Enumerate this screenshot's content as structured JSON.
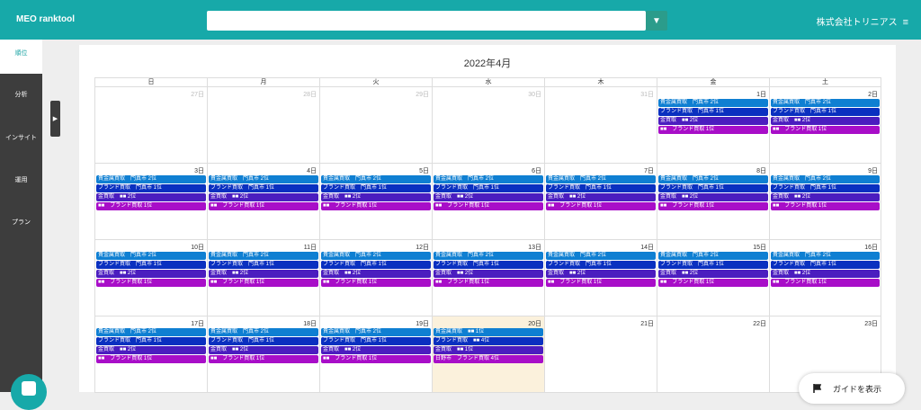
{
  "header": {
    "app_title": "MEO ranktool",
    "company": "株式会社トリニアス",
    "menu_icon": "hamburger-icon",
    "search_value": ""
  },
  "sidebar": {
    "items": [
      {
        "label": "順位",
        "active": true
      },
      {
        "label": "分析"
      },
      {
        "label": "インサイト"
      },
      {
        "label": "運用"
      },
      {
        "label": "プラン"
      }
    ],
    "toggle_icon": "▶"
  },
  "calendar": {
    "title": "2022年4月",
    "weekdays": [
      "日",
      "月",
      "火",
      "水",
      "木",
      "金",
      "土"
    ],
    "colors": {
      "blue1": "#0f7fd2",
      "blue2": "#0a30c0",
      "purple1": "#4b1dbf",
      "purple2": "#a80ec8",
      "today_bg": "#fbf1dc"
    },
    "weeks": [
      [
        {
          "label": "27日",
          "other": true,
          "events": []
        },
        {
          "label": "28日",
          "other": true,
          "events": []
        },
        {
          "label": "29日",
          "other": true,
          "events": []
        },
        {
          "label": "30日",
          "other": true,
          "events": []
        },
        {
          "label": "31日",
          "other": true,
          "events": []
        },
        {
          "label": "1日",
          "events": [
            {
              "text": "貴金属買取　門真市 2位",
              "color": "blue1"
            },
            {
              "text": "ブランド買取　門真市 1位",
              "color": "blue2"
            },
            {
              "text": "金買取　■■ 2位",
              "color": "purple1"
            },
            {
              "text": "■■　ブランド買取 1位",
              "color": "purple2"
            }
          ]
        },
        {
          "label": "2日",
          "events": [
            {
              "text": "貴金属買取　門真市 2位",
              "color": "blue1"
            },
            {
              "text": "ブランド買取　門真市 1位",
              "color": "blue2"
            },
            {
              "text": "金買取　■■ 2位",
              "color": "purple1"
            },
            {
              "text": "■■　ブランド買取 1位",
              "color": "purple2"
            }
          ]
        }
      ],
      [
        {
          "label": "3日",
          "events": [
            {
              "text": "貴金属買取　門真市 2位",
              "color": "blue1"
            },
            {
              "text": "ブランド買取　門真市 1位",
              "color": "blue2"
            },
            {
              "text": "金買取　■■ 2位",
              "color": "purple1"
            },
            {
              "text": "■■　ブランド買取 1位",
              "color": "purple2"
            }
          ]
        },
        {
          "label": "4日",
          "events": [
            {
              "text": "貴金属買取　門真市 2位",
              "color": "blue1"
            },
            {
              "text": "ブランド買取　門真市 1位",
              "color": "blue2"
            },
            {
              "text": "金買取　■■ 2位",
              "color": "purple1"
            },
            {
              "text": "■■　ブランド買取 1位",
              "color": "purple2"
            }
          ]
        },
        {
          "label": "5日",
          "events": [
            {
              "text": "貴金属買取　門真市 2位",
              "color": "blue1"
            },
            {
              "text": "ブランド買取　門真市 1位",
              "color": "blue2"
            },
            {
              "text": "金買取　■■ 2位",
              "color": "purple1"
            },
            {
              "text": "■■　ブランド買取 1位",
              "color": "purple2"
            }
          ]
        },
        {
          "label": "6日",
          "events": [
            {
              "text": "貴金属買取　門真市 2位",
              "color": "blue1"
            },
            {
              "text": "ブランド買取　門真市 1位",
              "color": "blue2"
            },
            {
              "text": "金買取　■■ 2位",
              "color": "purple1"
            },
            {
              "text": "■■　ブランド買取 1位",
              "color": "purple2"
            }
          ]
        },
        {
          "label": "7日",
          "events": [
            {
              "text": "貴金属買取　門真市 2位",
              "color": "blue1"
            },
            {
              "text": "ブランド買取　門真市 1位",
              "color": "blue2"
            },
            {
              "text": "金買取　■■ 2位",
              "color": "purple1"
            },
            {
              "text": "■■　ブランド買取 1位",
              "color": "purple2"
            }
          ]
        },
        {
          "label": "8日",
          "events": [
            {
              "text": "貴金属買取　門真市 2位",
              "color": "blue1"
            },
            {
              "text": "ブランド買取　門真市 1位",
              "color": "blue2"
            },
            {
              "text": "金買取　■■ 2位",
              "color": "purple1"
            },
            {
              "text": "■■　ブランド買取 1位",
              "color": "purple2"
            }
          ]
        },
        {
          "label": "9日",
          "events": [
            {
              "text": "貴金属買取　門真市 2位",
              "color": "blue1"
            },
            {
              "text": "ブランド買取　門真市 1位",
              "color": "blue2"
            },
            {
              "text": "金買取　■■ 2位",
              "color": "purple1"
            },
            {
              "text": "■■　ブランド買取 1位",
              "color": "purple2"
            }
          ]
        }
      ],
      [
        {
          "label": "10日",
          "events": [
            {
              "text": "貴金属買取　門真市 2位",
              "color": "blue1"
            },
            {
              "text": "ブランド買取　門真市 1位",
              "color": "blue2"
            },
            {
              "text": "金買取　■■ 2位",
              "color": "purple1"
            },
            {
              "text": "■■　ブランド買取 1位",
              "color": "purple2"
            }
          ]
        },
        {
          "label": "11日",
          "events": [
            {
              "text": "貴金属買取　門真市 2位",
              "color": "blue1"
            },
            {
              "text": "ブランド買取　門真市 1位",
              "color": "blue2"
            },
            {
              "text": "金買取　■■ 2位",
              "color": "purple1"
            },
            {
              "text": "■■　ブランド買取 1位",
              "color": "purple2"
            }
          ]
        },
        {
          "label": "12日",
          "events": [
            {
              "text": "貴金属買取　門真市 2位",
              "color": "blue1"
            },
            {
              "text": "ブランド買取　門真市 1位",
              "color": "blue2"
            },
            {
              "text": "金買取　■■ 2位",
              "color": "purple1"
            },
            {
              "text": "■■　ブランド買取 1位",
              "color": "purple2"
            }
          ]
        },
        {
          "label": "13日",
          "events": [
            {
              "text": "貴金属買取　門真市 2位",
              "color": "blue1"
            },
            {
              "text": "ブランド買取　門真市 1位",
              "color": "blue2"
            },
            {
              "text": "金買取　■■ 2位",
              "color": "purple1"
            },
            {
              "text": "■■　ブランド買取 1位",
              "color": "purple2"
            }
          ]
        },
        {
          "label": "14日",
          "events": [
            {
              "text": "貴金属買取　門真市 2位",
              "color": "blue1"
            },
            {
              "text": "ブランド買取　門真市 1位",
              "color": "blue2"
            },
            {
              "text": "金買取　■■ 2位",
              "color": "purple1"
            },
            {
              "text": "■■　ブランド買取 1位",
              "color": "purple2"
            }
          ]
        },
        {
          "label": "15日",
          "events": [
            {
              "text": "貴金属買取　門真市 2位",
              "color": "blue1"
            },
            {
              "text": "ブランド買取　門真市 1位",
              "color": "blue2"
            },
            {
              "text": "金買取　■■ 2位",
              "color": "purple1"
            },
            {
              "text": "■■　ブランド買取 1位",
              "color": "purple2"
            }
          ]
        },
        {
          "label": "16日",
          "events": [
            {
              "text": "貴金属買取　門真市 2位",
              "color": "blue1"
            },
            {
              "text": "ブランド買取　門真市 1位",
              "color": "blue2"
            },
            {
              "text": "金買取　■■ 2位",
              "color": "purple1"
            },
            {
              "text": "■■　ブランド買取 1位",
              "color": "purple2"
            }
          ]
        }
      ],
      [
        {
          "label": "17日",
          "events": [
            {
              "text": "貴金属買取　門真市 2位",
              "color": "blue1"
            },
            {
              "text": "ブランド買取　門真市 1位",
              "color": "blue2"
            },
            {
              "text": "金買取　■■ 2位",
              "color": "purple1"
            },
            {
              "text": "■■　ブランド買取 1位",
              "color": "purple2"
            }
          ]
        },
        {
          "label": "18日",
          "events": [
            {
              "text": "貴金属買取　門真市 2位",
              "color": "blue1"
            },
            {
              "text": "ブランド買取　門真市 1位",
              "color": "blue2"
            },
            {
              "text": "金買取　■■ 2位",
              "color": "purple1"
            },
            {
              "text": "■■　ブランド買取 1位",
              "color": "purple2"
            }
          ]
        },
        {
          "label": "19日",
          "events": [
            {
              "text": "貴金属買取　門真市 2位",
              "color": "blue1"
            },
            {
              "text": "ブランド買取　門真市 1位",
              "color": "blue2"
            },
            {
              "text": "金買取　■■ 2位",
              "color": "purple1"
            },
            {
              "text": "■■　ブランド買取 1位",
              "color": "purple2"
            }
          ]
        },
        {
          "label": "20日",
          "today": true,
          "events": [
            {
              "text": "貴金属買取　■■ 1位",
              "color": "blue1"
            },
            {
              "text": "ブランド買取　■■ 4位",
              "color": "blue2"
            },
            {
              "text": "金買取　■■ 1位",
              "color": "purple1"
            },
            {
              "text": "日野市　ブランド買取 4位",
              "color": "purple2"
            }
          ]
        },
        {
          "label": "21日",
          "events": []
        },
        {
          "label": "22日",
          "events": []
        },
        {
          "label": "23日",
          "events": []
        }
      ]
    ]
  },
  "guide": {
    "label": "ガイドを表示",
    "icon": "flag-icon"
  }
}
